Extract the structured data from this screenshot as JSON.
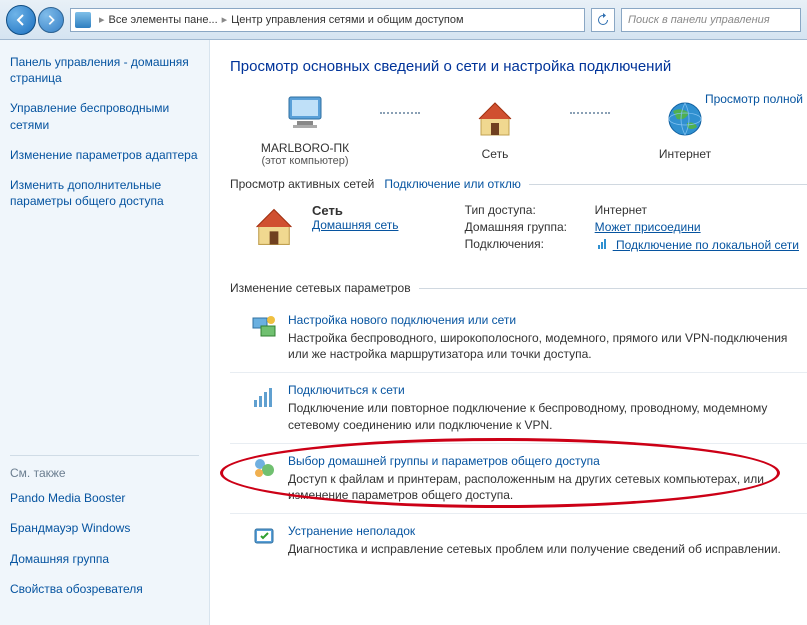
{
  "toolbar": {
    "breadcrumb_root": "Все элементы пане...",
    "breadcrumb_current": "Центр управления сетями и общим доступом",
    "search_placeholder": "Поиск в панели управления"
  },
  "sidebar": {
    "links": [
      "Панель управления - домашняя страница",
      "Управление беспроводными сетями",
      "Изменение параметров адаптера",
      "Изменить дополнительные параметры общего доступа"
    ],
    "see_also_header": "См. также",
    "see_also": [
      "Pando Media Booster",
      "Брандмауэр Windows",
      "Домашняя группа",
      "Свойства обозревателя"
    ]
  },
  "main": {
    "title": "Просмотр основных сведений о сети и настройка подключений",
    "view_full_map": "Просмотр полной",
    "map": {
      "this_pc": "MARLBORO-ПК",
      "this_pc_sub": "(этот компьютер)",
      "network": "Сеть",
      "internet": "Интернет"
    },
    "active_header": "Просмотр активных сетей",
    "active_link": "Подключение или отклю",
    "active_net": {
      "name": "Сеть",
      "type": "Домашняя сеть",
      "props": {
        "access_type_k": "Тип доступа:",
        "access_type_v": "Интернет",
        "homegroup_k": "Домашняя группа:",
        "homegroup_v": "Может присоедини",
        "connections_k": "Подключения:",
        "connections_v": "Подключение по локальной сети"
      }
    },
    "change_header": "Изменение сетевых параметров",
    "tasks": [
      {
        "title": "Настройка нового подключения или сети",
        "desc": "Настройка беспроводного, широкополосного, модемного, прямого или VPN-подключения или же настройка маршрутизатора или точки доступа."
      },
      {
        "title": "Подключиться к сети",
        "desc": "Подключение или повторное подключение к беспроводному, проводному, модемному сетевому соединению или подключение к VPN."
      },
      {
        "title": "Выбор домашней группы и параметров общего доступа",
        "desc": "Доступ к файлам и принтерам, расположенным на других сетевых компьютерах, или изменение параметров общего доступа."
      },
      {
        "title": "Устранение неполадок",
        "desc": "Диагностика и исправление сетевых проблем или получение сведений об исправлении."
      }
    ]
  }
}
